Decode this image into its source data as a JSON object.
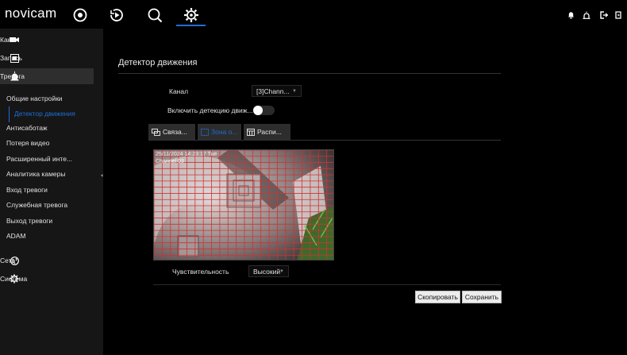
{
  "header": {
    "logo": "novicam",
    "nav": [
      "live-view-icon",
      "playback-icon",
      "search-icon",
      "settings-icon"
    ],
    "active_nav": "settings-icon",
    "tray": [
      "bell-icon",
      "alarm-icon",
      "logout-icon",
      "exit-icon"
    ]
  },
  "sidebar": {
    "groups": {
      "channel": "Канал",
      "record": "Запись",
      "alarm": "Тревога",
      "network": "Сеть",
      "system": "Система"
    },
    "alarm_items": [
      "Общие настройки",
      "Детектор движения",
      "Антисаботаж",
      "Потеря видео",
      "Расширенный инте...",
      "Аналитика камеры",
      "Вход тревоги",
      "Служебная тревога",
      "Выход тревоги",
      "ADAM"
    ],
    "selected_item": "Детектор движения",
    "collapse_glyph": "<"
  },
  "main": {
    "title": "Детектор движения",
    "channel_label": "Канал",
    "channel_value": "[3]Chann...",
    "enable_label": "Включить детекцию движ...",
    "enable_on": true,
    "tabs": [
      "Связа...",
      "Зона о...",
      "Распи..."
    ],
    "active_tab": "Зона о...",
    "preview": {
      "timestamp": "25/11/2024 14:23:17 Tue",
      "channel_name": "Channel 03"
    },
    "sensitivity_label": "Чувствительность",
    "sensitivity_value": "Высокий",
    "copy_button": "Скопировать",
    "save_button": "Сохранить",
    "accent_color": "#1e6fd6",
    "grid_color": "#d23232"
  }
}
